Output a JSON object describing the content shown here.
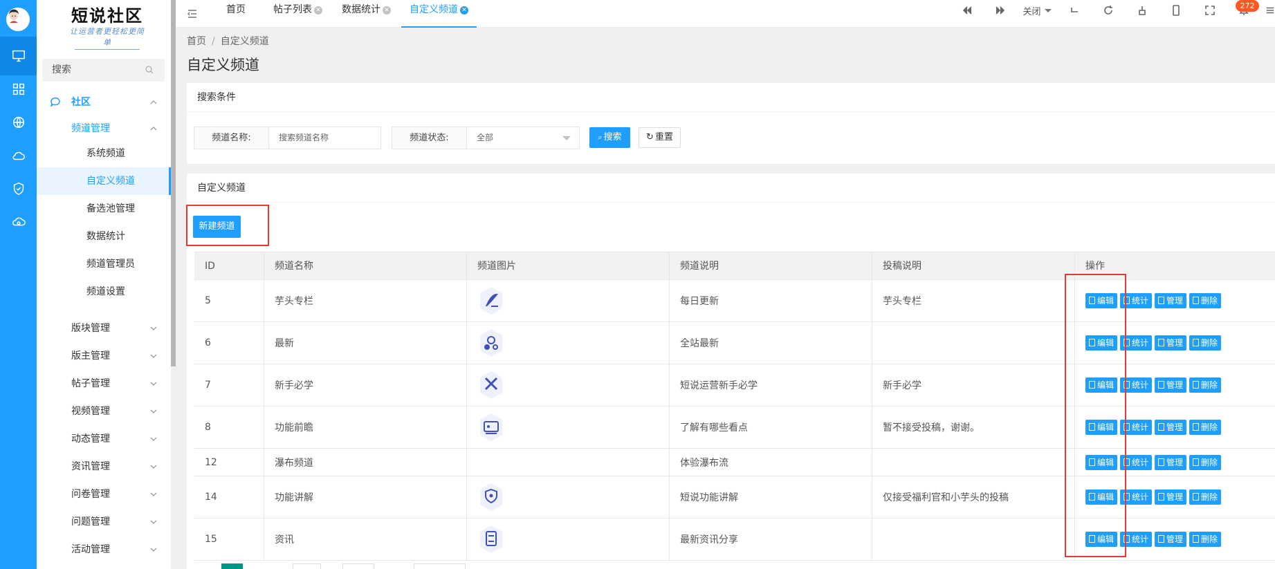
{
  "brand": {
    "title": "短说社区",
    "slogan": "让运营者更轻松更简单"
  },
  "sidebar": {
    "search_label": "搜索",
    "groups": [
      {
        "label": "社区"
      },
      {
        "label": "频道管理"
      }
    ],
    "sub_items": [
      "系统频道",
      "自定义频道",
      "备选池管理",
      "数据统计",
      "频道管理员",
      "频道设置"
    ],
    "more_groups": [
      "版块管理",
      "版主管理",
      "帖子管理",
      "视频管理",
      "动态管理",
      "资讯管理",
      "问卷管理",
      "问题管理",
      "活动管理"
    ]
  },
  "topbar": {
    "tabs": [
      "首页",
      "帖子列表",
      "数据统计",
      "自定义频道"
    ],
    "close_label": "关闭",
    "notification_count": "272"
  },
  "breadcrumb": [
    "首页",
    "自定义频道"
  ],
  "page_title": "自定义频道",
  "search_card": {
    "title": "搜索条件",
    "name_label": "频道名称:",
    "name_placeholder": "搜索频道名称",
    "status_label": "频道状态:",
    "status_value": "全部",
    "search_button": "搜索",
    "reset_button": "重置"
  },
  "list_card": {
    "title": "自定义频道",
    "new_button": "新建频道",
    "columns": [
      "ID",
      "频道名称",
      "频道图片",
      "频道说明",
      "投稿说明",
      "操作"
    ],
    "actions": [
      "编辑",
      "统计",
      "管理",
      "删除"
    ],
    "rows": [
      {
        "id": "5",
        "name": "芋头专栏",
        "icon": "quill-icon",
        "desc": "每日更新",
        "submit": "芋头专栏"
      },
      {
        "id": "6",
        "name": "最新",
        "icon": "bubbles-icon",
        "desc": "全站最新",
        "submit": ""
      },
      {
        "id": "7",
        "name": "新手必学",
        "icon": "tools-icon",
        "desc": "短说运营新手必学",
        "submit": "新手必学"
      },
      {
        "id": "8",
        "name": "功能前瞻",
        "icon": "screen-icon",
        "desc": "了解有哪些看点",
        "submit": "暂不接受投稿，谢谢。"
      },
      {
        "id": "12",
        "name": "瀑布频道",
        "icon": "",
        "desc": "体验瀑布流",
        "submit": ""
      },
      {
        "id": "14",
        "name": "功能讲解",
        "icon": "shield-icon",
        "desc": "短说功能讲解",
        "submit": "仅接受福利官和小芋头的投稿"
      },
      {
        "id": "15",
        "name": "资讯",
        "icon": "doc-icon",
        "desc": "最新资讯分享",
        "submit": ""
      }
    ]
  },
  "colors": {
    "accent": "#1e9fff",
    "highlight_box": "#e53935",
    "badge": "#ff5722"
  }
}
